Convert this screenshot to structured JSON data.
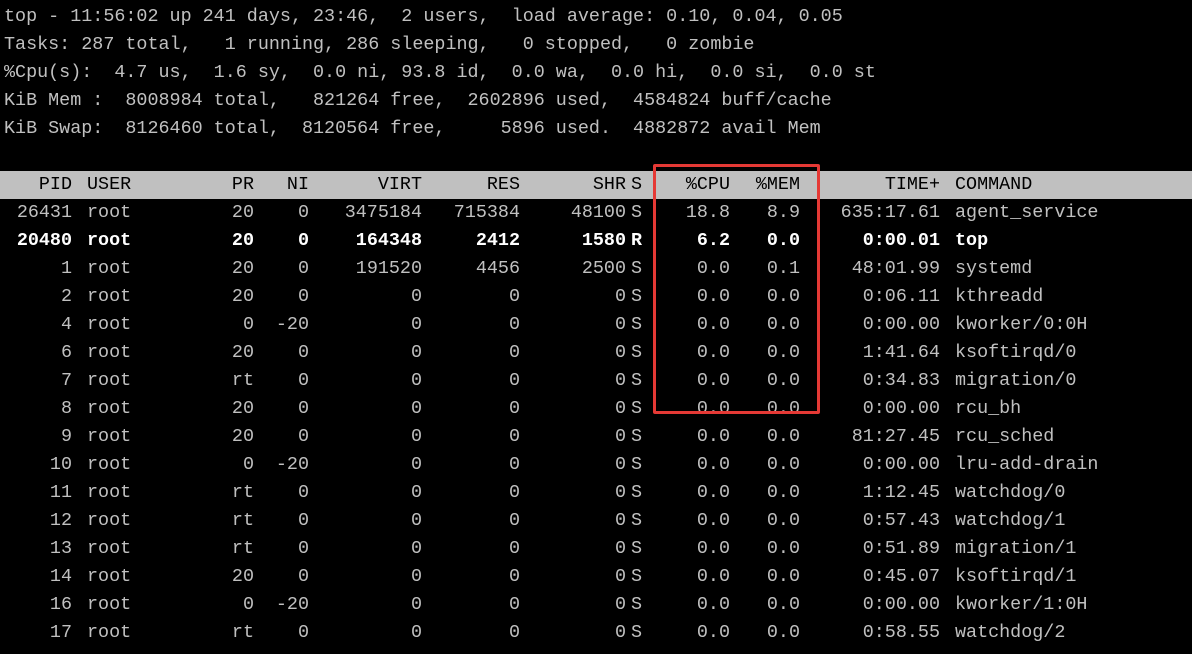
{
  "summary": {
    "line1": "top - 11:56:02 up 241 days, 23:46,  2 users,  load average: 0.10, 0.04, 0.05",
    "line2": "Tasks: 287 total,   1 running, 286 sleeping,   0 stopped,   0 zombie",
    "line3": "%Cpu(s):  4.7 us,  1.6 sy,  0.0 ni, 93.8 id,  0.0 wa,  0.0 hi,  0.0 si,  0.0 st",
    "line4": "KiB Mem :  8008984 total,   821264 free,  2602896 used,  4584824 buff/cache",
    "line5": "KiB Swap:  8126460 total,  8120564 free,     5896 used.  4882872 avail Mem"
  },
  "columns": [
    "PID",
    "USER",
    "PR",
    "NI",
    "VIRT",
    "RES",
    "SHR",
    "S",
    "%CPU",
    "%MEM",
    "TIME+",
    "COMMAND"
  ],
  "processes": [
    [
      "26431",
      "root",
      "20",
      "0",
      "3475184",
      "715384",
      "48100",
      "S",
      "18.8",
      "8.9",
      "635:17.61",
      "agent_service"
    ],
    [
      "20480",
      "root",
      "20",
      "0",
      "164348",
      "2412",
      "1580",
      "R",
      "6.2",
      "0.0",
      "0:00.01",
      "top"
    ],
    [
      "1",
      "root",
      "20",
      "0",
      "191520",
      "4456",
      "2500",
      "S",
      "0.0",
      "0.1",
      "48:01.99",
      "systemd"
    ],
    [
      "2",
      "root",
      "20",
      "0",
      "0",
      "0",
      "0",
      "S",
      "0.0",
      "0.0",
      "0:06.11",
      "kthreadd"
    ],
    [
      "4",
      "root",
      "0",
      "-20",
      "0",
      "0",
      "0",
      "S",
      "0.0",
      "0.0",
      "0:00.00",
      "kworker/0:0H"
    ],
    [
      "6",
      "root",
      "20",
      "0",
      "0",
      "0",
      "0",
      "S",
      "0.0",
      "0.0",
      "1:41.64",
      "ksoftirqd/0"
    ],
    [
      "7",
      "root",
      "rt",
      "0",
      "0",
      "0",
      "0",
      "S",
      "0.0",
      "0.0",
      "0:34.83",
      "migration/0"
    ],
    [
      "8",
      "root",
      "20",
      "0",
      "0",
      "0",
      "0",
      "S",
      "0.0",
      "0.0",
      "0:00.00",
      "rcu_bh"
    ],
    [
      "9",
      "root",
      "20",
      "0",
      "0",
      "0",
      "0",
      "S",
      "0.0",
      "0.0",
      "81:27.45",
      "rcu_sched"
    ],
    [
      "10",
      "root",
      "0",
      "-20",
      "0",
      "0",
      "0",
      "S",
      "0.0",
      "0.0",
      "0:00.00",
      "lru-add-drain"
    ],
    [
      "11",
      "root",
      "rt",
      "0",
      "0",
      "0",
      "0",
      "S",
      "0.0",
      "0.0",
      "1:12.45",
      "watchdog/0"
    ],
    [
      "12",
      "root",
      "rt",
      "0",
      "0",
      "0",
      "0",
      "S",
      "0.0",
      "0.0",
      "0:57.43",
      "watchdog/1"
    ],
    [
      "13",
      "root",
      "rt",
      "0",
      "0",
      "0",
      "0",
      "S",
      "0.0",
      "0.0",
      "0:51.89",
      "migration/1"
    ],
    [
      "14",
      "root",
      "20",
      "0",
      "0",
      "0",
      "0",
      "S",
      "0.0",
      "0.0",
      "0:45.07",
      "ksoftirqd/1"
    ],
    [
      "16",
      "root",
      "0",
      "-20",
      "0",
      "0",
      "0",
      "S",
      "0.0",
      "0.0",
      "0:00.00",
      "kworker/1:0H"
    ],
    [
      "17",
      "root",
      "rt",
      "0",
      "0",
      "0",
      "0",
      "S",
      "0.0",
      "0.0",
      "0:58.55",
      "watchdog/2"
    ]
  ],
  "colors": {
    "background": "#000000",
    "text": "#c0c0c0",
    "running_text": "#ffffff",
    "header_bg": "#c0c0c0",
    "header_text": "#000000",
    "highlight": "#e53935"
  }
}
